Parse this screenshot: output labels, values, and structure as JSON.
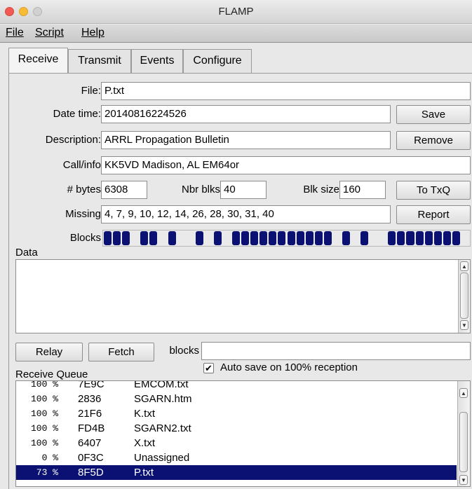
{
  "window": {
    "title": "FLAMP"
  },
  "menu": {
    "file": "File",
    "script": "Script",
    "help": "Help"
  },
  "tabs": [
    "Receive",
    "Transmit",
    "Events",
    "Configure"
  ],
  "form": {
    "file_label": "File:",
    "file_value": "P.txt",
    "datetime_label": "Date time:",
    "datetime_value": "20140816224526",
    "description_label": "Description:",
    "description_value": "ARRL Propagation Bulletin",
    "callinfo_label": "Call/info",
    "callinfo_value": "KK5VD Madison, AL EM64or",
    "bytes_label": "# bytes",
    "bytes_value": "6308",
    "nbrblks_label": "Nbr blks",
    "nbrblks_value": "40",
    "blksize_label": "Blk size",
    "blksize_value": "160",
    "missing_label": "Missing",
    "missing_value": "4, 7, 9, 10, 12, 14, 26, 28, 30, 31, 40",
    "blocks_label": "Blocks"
  },
  "buttons": {
    "save": "Save",
    "remove": "Remove",
    "to_txq": "To TxQ",
    "report": "Report",
    "relay": "Relay",
    "fetch": "Fetch"
  },
  "blocks": {
    "total": 40,
    "missing": [
      4,
      7,
      9,
      10,
      12,
      14,
      26,
      28,
      30,
      31,
      40
    ],
    "received_color": "#0a1172"
  },
  "data_section": {
    "label": "Data"
  },
  "relay_row": {
    "blocks_label": "blocks",
    "blocks_value": ""
  },
  "receive_queue": {
    "label": "Receive Queue",
    "autosave_label": "Auto save on 100% reception",
    "autosave_checked": true,
    "rows": [
      {
        "pct": "100 %",
        "hash": "7E9C",
        "name": "EMCOM.txt",
        "selected": false
      },
      {
        "pct": "100 %",
        "hash": "2836",
        "name": "SGARN.htm",
        "selected": false
      },
      {
        "pct": "100 %",
        "hash": "21F6",
        "name": "K.txt",
        "selected": false
      },
      {
        "pct": "100 %",
        "hash": "FD4B",
        "name": "SGARN2.txt",
        "selected": false
      },
      {
        "pct": "100 %",
        "hash": "6407",
        "name": "X.txt",
        "selected": false
      },
      {
        "pct": "0 %",
        "hash": "0F3C",
        "name": "Unassigned",
        "selected": false
      },
      {
        "pct": "73 %",
        "hash": "8F5D",
        "name": "P.txt",
        "selected": true
      }
    ]
  },
  "icons": {
    "close": "close-icon",
    "minimize": "minimize-icon",
    "zoom": "zoom-icon",
    "scroll_up": "arrow-up-icon",
    "scroll_down": "arrow-down-icon",
    "check": "checkmark-icon"
  }
}
